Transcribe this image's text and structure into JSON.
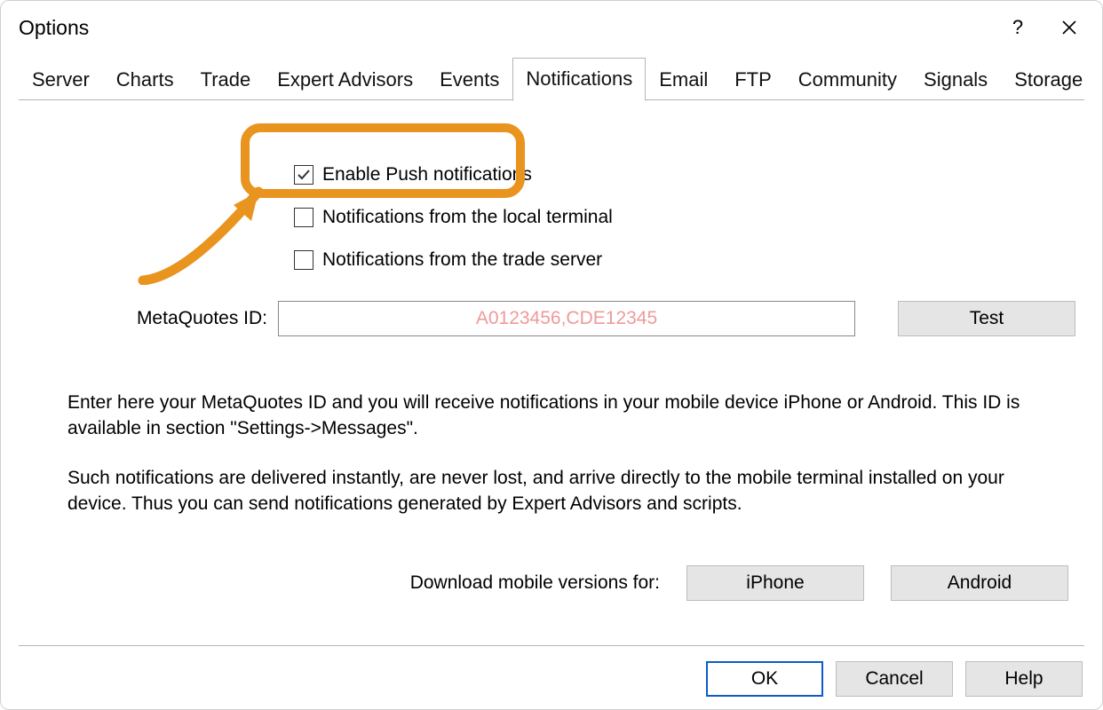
{
  "window": {
    "title": "Options"
  },
  "tabs": [
    "Server",
    "Charts",
    "Trade",
    "Expert Advisors",
    "Events",
    "Notifications",
    "Email",
    "FTP",
    "Community",
    "Signals",
    "Storage"
  ],
  "selected_tab_index": 5,
  "notifications": {
    "enable_push": {
      "checked": true,
      "label": "Enable Push notifications"
    },
    "from_local": {
      "checked": false,
      "label": "Notifications from the local terminal"
    },
    "from_server": {
      "checked": false,
      "label": "Notifications from the trade server"
    },
    "mqid_label": "MetaQuotes ID:",
    "mqid_placeholder": "A0123456,CDE12345",
    "mqid_value": "",
    "test_button": "Test",
    "description_1": "Enter here your MetaQuotes ID and you will receive notifications in your mobile device iPhone or Android. This ID is available in section \"Settings->Messages\".",
    "description_2": "Such notifications are delivered instantly, are never lost, and arrive directly to the mobile terminal installed on your device. Thus you can send notifications generated by Expert Advisors and scripts.",
    "download_label": "Download mobile versions for:",
    "download_iphone": "iPhone",
    "download_android": "Android"
  },
  "footer": {
    "ok": "OK",
    "cancel": "Cancel",
    "help": "Help"
  }
}
